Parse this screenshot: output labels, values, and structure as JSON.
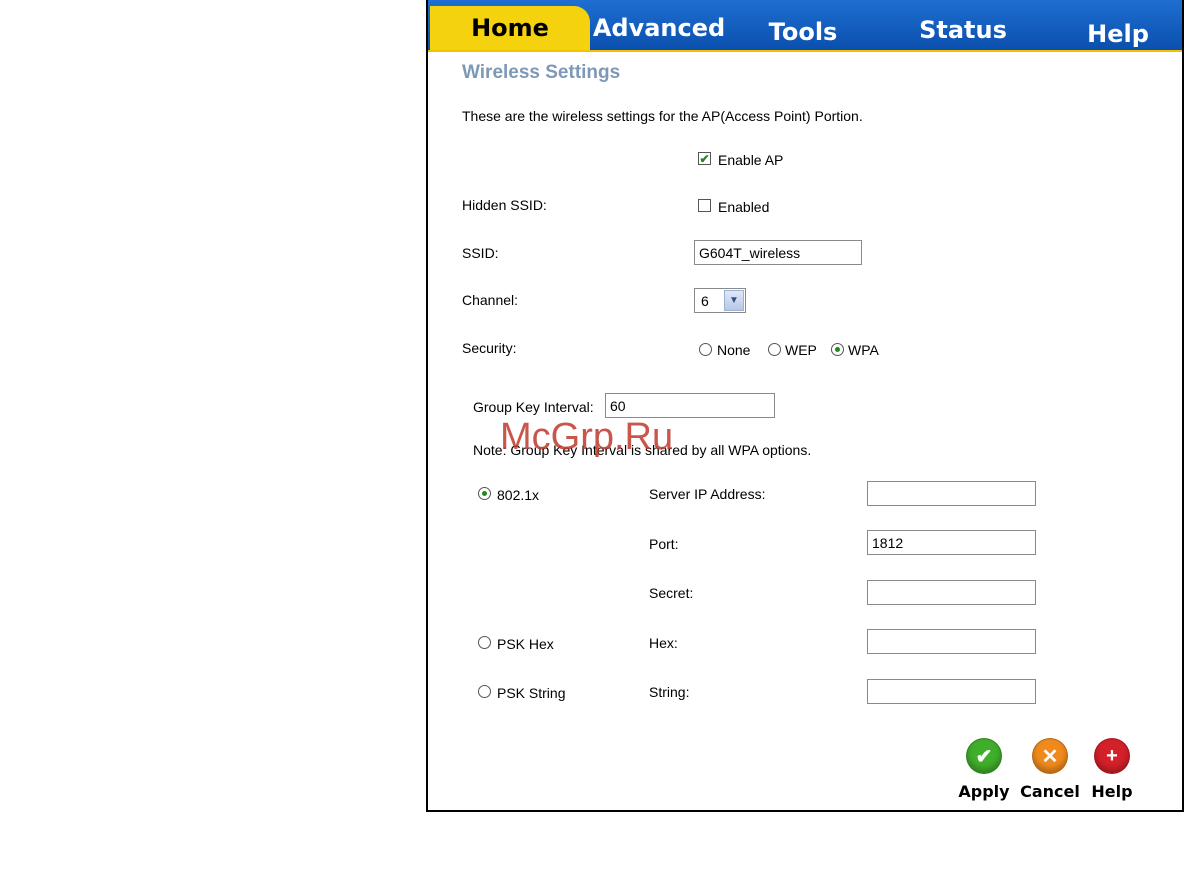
{
  "tabs": [
    {
      "label": "Home",
      "active": true
    },
    {
      "label": "Advanced"
    },
    {
      "label": "Tools"
    },
    {
      "label": "Status"
    },
    {
      "label": "Help"
    }
  ],
  "page": {
    "title": "Wireless Settings",
    "description": "These are the wireless settings for the AP(Access Point) Portion."
  },
  "form": {
    "enable_ap_label": "Enable AP",
    "enable_ap_checked": true,
    "hidden_ssid_label": "Hidden SSID:",
    "hidden_ssid_option": "Enabled",
    "hidden_ssid_checked": false,
    "ssid_label": "SSID:",
    "ssid_value": "G604T_wireless",
    "channel_label": "Channel:",
    "channel_value": "6",
    "security_label": "Security:",
    "security_options": [
      "None",
      "WEP",
      "WPA"
    ],
    "security_selected": "WPA",
    "group_key_label": "Group Key Interval:",
    "group_key_value": "60",
    "note": "Note: Group Key Interval is shared by all WPA options.",
    "wpa_modes": {
      "dot1x": {
        "label": "802.1x",
        "selected": true,
        "server_ip_label": "Server IP Address:",
        "server_ip_value": "",
        "port_label": "Port:",
        "port_value": "1812",
        "secret_label": "Secret:",
        "secret_value": ""
      },
      "psk_hex": {
        "label": "PSK Hex",
        "field_label": "Hex:",
        "value": ""
      },
      "psk_string": {
        "label": "PSK String",
        "field_label": "String:",
        "value": ""
      }
    }
  },
  "actions": {
    "apply": "Apply",
    "cancel": "Cancel",
    "help": "Help"
  },
  "watermark": "McGrp.Ru",
  "colors": {
    "tab_active": "#f4d20e",
    "tab_bar": "#0b4fae",
    "title": "#7d98b8",
    "apply": "#3fae2a",
    "cancel": "#f08a1c",
    "help": "#d42029"
  }
}
